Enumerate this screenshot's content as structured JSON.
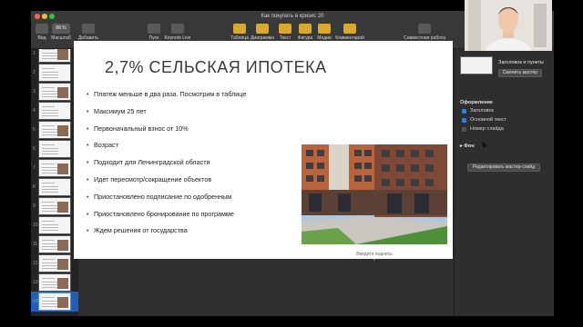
{
  "window": {
    "title": "Как покупать в кризис 20"
  },
  "toolbar": {
    "items": [
      {
        "label": "Вид"
      },
      {
        "label": "Масштаб",
        "value": "88 %"
      },
      {
        "label": "Добавить слайд"
      },
      {
        "label": "Пуск"
      },
      {
        "label": "Keynote Live"
      },
      {
        "label": "Таблица"
      },
      {
        "label": "Диаграмма"
      },
      {
        "label": "Текст"
      },
      {
        "label": "Фигура"
      },
      {
        "label": "Медиа"
      },
      {
        "label": "Комментарий"
      },
      {
        "label": "Совместная работа"
      }
    ]
  },
  "sidebar": {
    "numbers": [
      "1",
      "2",
      "3",
      "4",
      "5",
      "6",
      "7",
      "8",
      "9",
      "10",
      "11",
      "12",
      "13",
      "14"
    ],
    "active_index": 13
  },
  "slide": {
    "title": "2,7% СЕЛЬСКАЯ ИПОТЕКА",
    "bullets": [
      "Платеж меньше в два раза. Посмотрим в таблице",
      "Максимум 25 лет",
      "Первоначальный взнос от 10%",
      "Возраст",
      "Подходит для Ленинградской области",
      "Идет пересмотр/сокращение объектов",
      "Приостановлено подписание по одобренным",
      "Приостановлено бронирование по программе",
      "Ждем решения от государства"
    ],
    "caption": "Введите подпись"
  },
  "inspector": {
    "layout_name": "Заголовок и пункты",
    "change_master": "Сменить мастер",
    "section_title": "Оформление",
    "checkboxes": [
      {
        "label": "Заголовок",
        "checked": true
      },
      {
        "label": "Основной текст",
        "checked": true
      },
      {
        "label": "Номер слайда",
        "checked": false
      }
    ],
    "background_label": "Фон",
    "edit_master": "Редактировать мастер-слайд"
  },
  "colors": {
    "accent": "#2f7df0",
    "selection": "#1f5fb8"
  }
}
